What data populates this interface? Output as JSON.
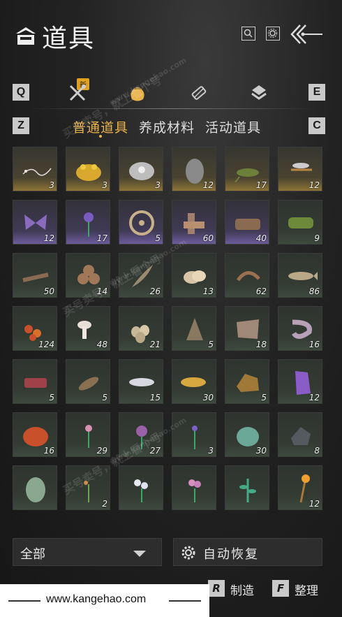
{
  "header": {
    "title": "道具"
  },
  "category_tabs": {
    "left_key": "Q",
    "right_key": "E",
    "new_badge": "新",
    "icons": [
      "tools-icon",
      "pouch-icon",
      "scroll-icon",
      "badge-icon"
    ],
    "active_index": 1
  },
  "sub_tabs": {
    "left_key": "Z",
    "right_key": "C",
    "items": [
      "普通道具",
      "养成材料",
      "活动道具"
    ],
    "active_index": 0
  },
  "items": [
    {
      "name": "silver-thread",
      "qty": "3",
      "rarity": "gold"
    },
    {
      "name": "golden-toad",
      "qty": "3",
      "rarity": "gold"
    },
    {
      "name": "pearl-shell",
      "qty": "3",
      "rarity": "gold"
    },
    {
      "name": "stone-cocoon",
      "qty": "12",
      "rarity": "gold"
    },
    {
      "name": "grasshopper",
      "qty": "17",
      "rarity": "gold"
    },
    {
      "name": "dragonfly",
      "qty": "12",
      "rarity": "gold"
    },
    {
      "name": "purple-butterfly",
      "qty": "12",
      "rarity": "purple"
    },
    {
      "name": "violet-flower",
      "qty": "17",
      "rarity": "purple"
    },
    {
      "name": "wheel",
      "qty": "5",
      "rarity": "purple"
    },
    {
      "name": "wood-blocks",
      "qty": "60",
      "rarity": "purple"
    },
    {
      "name": "firewood-bundle",
      "qty": "40",
      "rarity": "purple"
    },
    {
      "name": "bamboo-bundle",
      "qty": "9",
      "rarity": "green"
    },
    {
      "name": "wood-branches",
      "qty": "50",
      "rarity": "green"
    },
    {
      "name": "log-pile",
      "qty": "14",
      "rarity": "green"
    },
    {
      "name": "feather",
      "qty": "26",
      "rarity": "green"
    },
    {
      "name": "shellfish",
      "qty": "13",
      "rarity": "green"
    },
    {
      "name": "shrimp",
      "qty": "62",
      "rarity": "green"
    },
    {
      "name": "fish",
      "qty": "86",
      "rarity": "green"
    },
    {
      "name": "red-berries",
      "qty": "124",
      "rarity": "green"
    },
    {
      "name": "mushrooms",
      "qty": "48",
      "rarity": "green"
    },
    {
      "name": "eggs",
      "qty": "21",
      "rarity": "green"
    },
    {
      "name": "feathers-bundle",
      "qty": "5",
      "rarity": "green"
    },
    {
      "name": "animal-hide",
      "qty": "18",
      "rarity": "green"
    },
    {
      "name": "intestine",
      "qty": "16",
      "rarity": "green"
    },
    {
      "name": "raw-meat",
      "qty": "5",
      "rarity": "green"
    },
    {
      "name": "dried-fish",
      "qty": "5",
      "rarity": "green"
    },
    {
      "name": "silver-fish",
      "qty": "15",
      "rarity": "green"
    },
    {
      "name": "golden-carp",
      "qty": "30",
      "rarity": "green"
    },
    {
      "name": "copper-ore",
      "qty": "5",
      "rarity": "green"
    },
    {
      "name": "amethyst",
      "qty": "12",
      "rarity": "green"
    },
    {
      "name": "red-agate",
      "qty": "16",
      "rarity": "green"
    },
    {
      "name": "pink-herb",
      "qty": "29",
      "rarity": "green"
    },
    {
      "name": "purple-orchid",
      "qty": "27",
      "rarity": "green"
    },
    {
      "name": "lavender",
      "qty": "3",
      "rarity": "green"
    },
    {
      "name": "jade-stone",
      "qty": "30",
      "rarity": "green"
    },
    {
      "name": "iron-ore",
      "qty": "8",
      "rarity": "green"
    },
    {
      "name": "green-gourd",
      "qty": "",
      "rarity": "green"
    },
    {
      "name": "red-sprig",
      "qty": "2",
      "rarity": "green"
    },
    {
      "name": "white-flowers",
      "qty": "",
      "rarity": "green"
    },
    {
      "name": "pink-flowers",
      "qty": "",
      "rarity": "green"
    },
    {
      "name": "green-herb",
      "qty": "",
      "rarity": "green"
    },
    {
      "name": "firework",
      "qty": "12",
      "rarity": "green"
    }
  ],
  "bottom": {
    "filter_label": "全部",
    "auto_restore_label": "自动恢复"
  },
  "actions": [
    {
      "key": "R",
      "label": "制造"
    },
    {
      "key": "F",
      "label": "整理"
    }
  ],
  "watermark": {
    "url": "www.kangehao.com",
    "overlay_text": "买号卖号，就上看个号",
    "overlay_url": "www.kangehao.com"
  },
  "colors": {
    "accent": "#e8b24a",
    "gold_rarity": "#8c7436",
    "purple_rarity": "#6c5c9c",
    "green_rarity": "#3e4a3e"
  }
}
